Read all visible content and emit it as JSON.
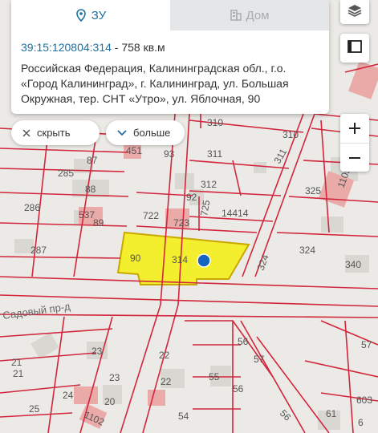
{
  "tabs": {
    "active_label": "ЗУ",
    "inactive_label": "Дом"
  },
  "parcel": {
    "cadastral_number": "39:15:120804:314",
    "separator": " - ",
    "area": "758 кв.м",
    "address": "Российская Федерация, Калининградская обл., г.о. «Город Калининград», г. Калининград, ул. Большая Окружная, тер. СНТ «Утро», ул. Яблочная, 90"
  },
  "chips": {
    "hide_label": "скрыть",
    "more_label": "больше"
  },
  "colors": {
    "accent": "#1f6f9e",
    "boundary": "#d2263c",
    "selected_fill": "#f3ee2e",
    "marker": "#1565c0"
  },
  "icons": {
    "active_tab": "location-pin-icon",
    "inactive_tab": "building-icon",
    "layers": "layers-icon",
    "frame": "frame-icon",
    "zoom_in": "plus-icon",
    "zoom_out": "minus-icon",
    "hide": "close-icon",
    "more": "chevron-down-icon"
  },
  "map": {
    "street_name": "Садовый пр-д",
    "labels": [
      "310",
      "310",
      "311",
      "311",
      "312",
      "93",
      "92",
      "87",
      "88",
      "89",
      "285",
      "286",
      "287",
      "537",
      "451",
      "722",
      "723",
      "725",
      "14414",
      "90",
      "314",
      "324",
      "324",
      "325",
      "1105",
      "340",
      "56",
      "57",
      "57",
      "22",
      "22",
      "23",
      "23",
      "21",
      "21",
      "24",
      "25",
      "20",
      "1102",
      "55",
      "56",
      "56",
      "54",
      "61",
      "603",
      "6"
    ]
  }
}
